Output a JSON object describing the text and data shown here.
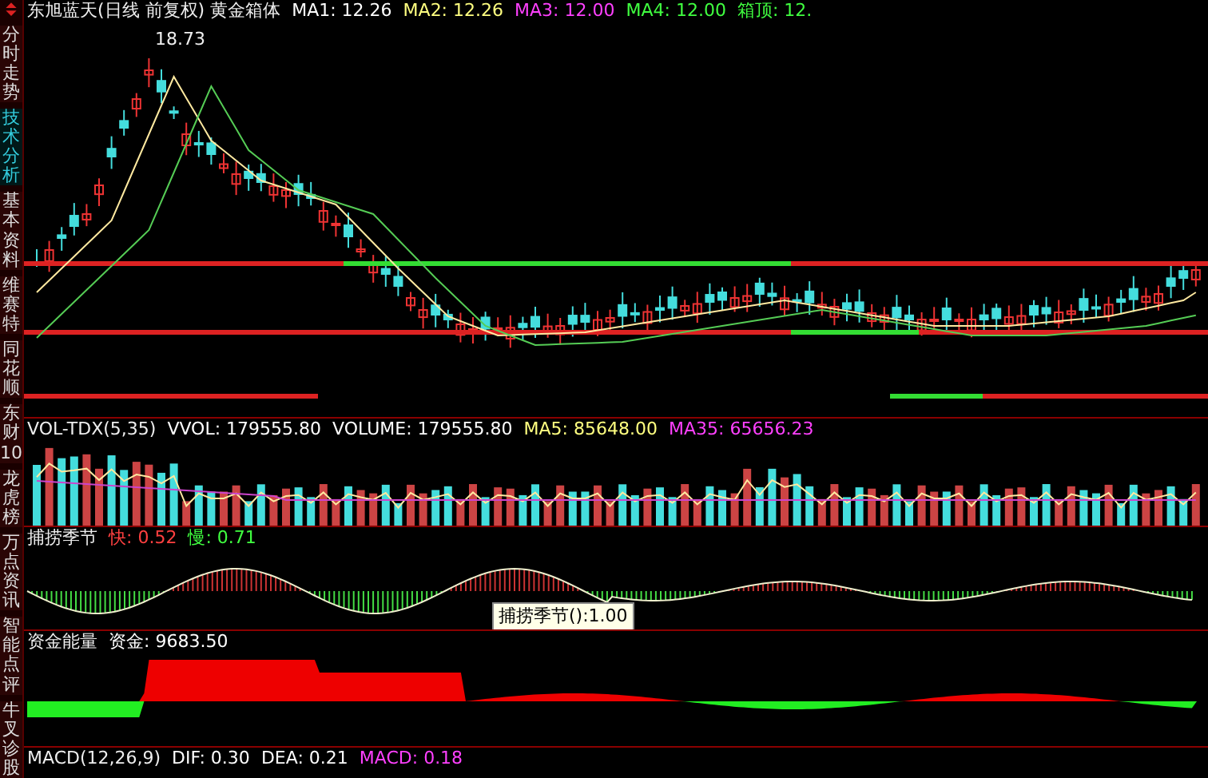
{
  "sidebar": {
    "items": [
      {
        "label": "分时走势",
        "selected": false
      },
      {
        "label": "技术分析",
        "selected": true
      },
      {
        "label": "基本资料",
        "selected": false
      },
      {
        "label": "维赛特",
        "selected": false
      },
      {
        "label": "同花顺",
        "selected": false
      },
      {
        "label": "东财10",
        "selected": false
      },
      {
        "label": "龙虎榜",
        "selected": false
      },
      {
        "label": "万点资讯",
        "selected": false
      },
      {
        "label": "智能点评",
        "selected": false
      },
      {
        "label": "牛叉诊股",
        "selected": false
      }
    ]
  },
  "panels": [
    {
      "kind": "price",
      "title": "东旭蓝天(日线 前复权) 黄金箱体",
      "legend": [
        {
          "text": "MA1: 12.26",
          "color": "#ffffff"
        },
        {
          "text": "MA2: 12.26",
          "color": "#ffff80"
        },
        {
          "text": "MA3: 12.00",
          "color": "#ff40ff"
        },
        {
          "text": "MA4: 12.00",
          "color": "#40ff40"
        },
        {
          "text": "箱顶: 12.",
          "color": "#40ff40"
        }
      ],
      "peak_label": "18.73"
    },
    {
      "kind": "volume",
      "title": "VOL-TDX(5,35)",
      "legend": [
        {
          "text": "VVOL: 179555.80",
          "color": "#ffffff"
        },
        {
          "text": "VOLUME: 179555.80",
          "color": "#ffffff"
        },
        {
          "text": "MA5: 85648.00",
          "color": "#ffff80"
        },
        {
          "text": "MA35: 65656.23",
          "color": "#ff40ff"
        }
      ]
    },
    {
      "kind": "oscillator",
      "title": "捕捞季节",
      "legend": [
        {
          "text": "快: 0.52",
          "color": "#ff4040"
        },
        {
          "text": "慢: 0.71",
          "color": "#40ff40"
        }
      ],
      "tooltip": "捕捞季节():1.00"
    },
    {
      "kind": "fund",
      "title": "资金能量",
      "legend": [
        {
          "text": "资金: 9683.50",
          "color": "#ffffff"
        }
      ]
    },
    {
      "kind": "macd",
      "title": "MACD(12,26,9)",
      "legend": [
        {
          "text": "DIF: 0.30",
          "color": "#ffffff"
        },
        {
          "text": "DEA: 0.21",
          "color": "#ffffff"
        },
        {
          "text": "MACD: 0.18",
          "color": "#ff40ff"
        }
      ]
    }
  ]
}
